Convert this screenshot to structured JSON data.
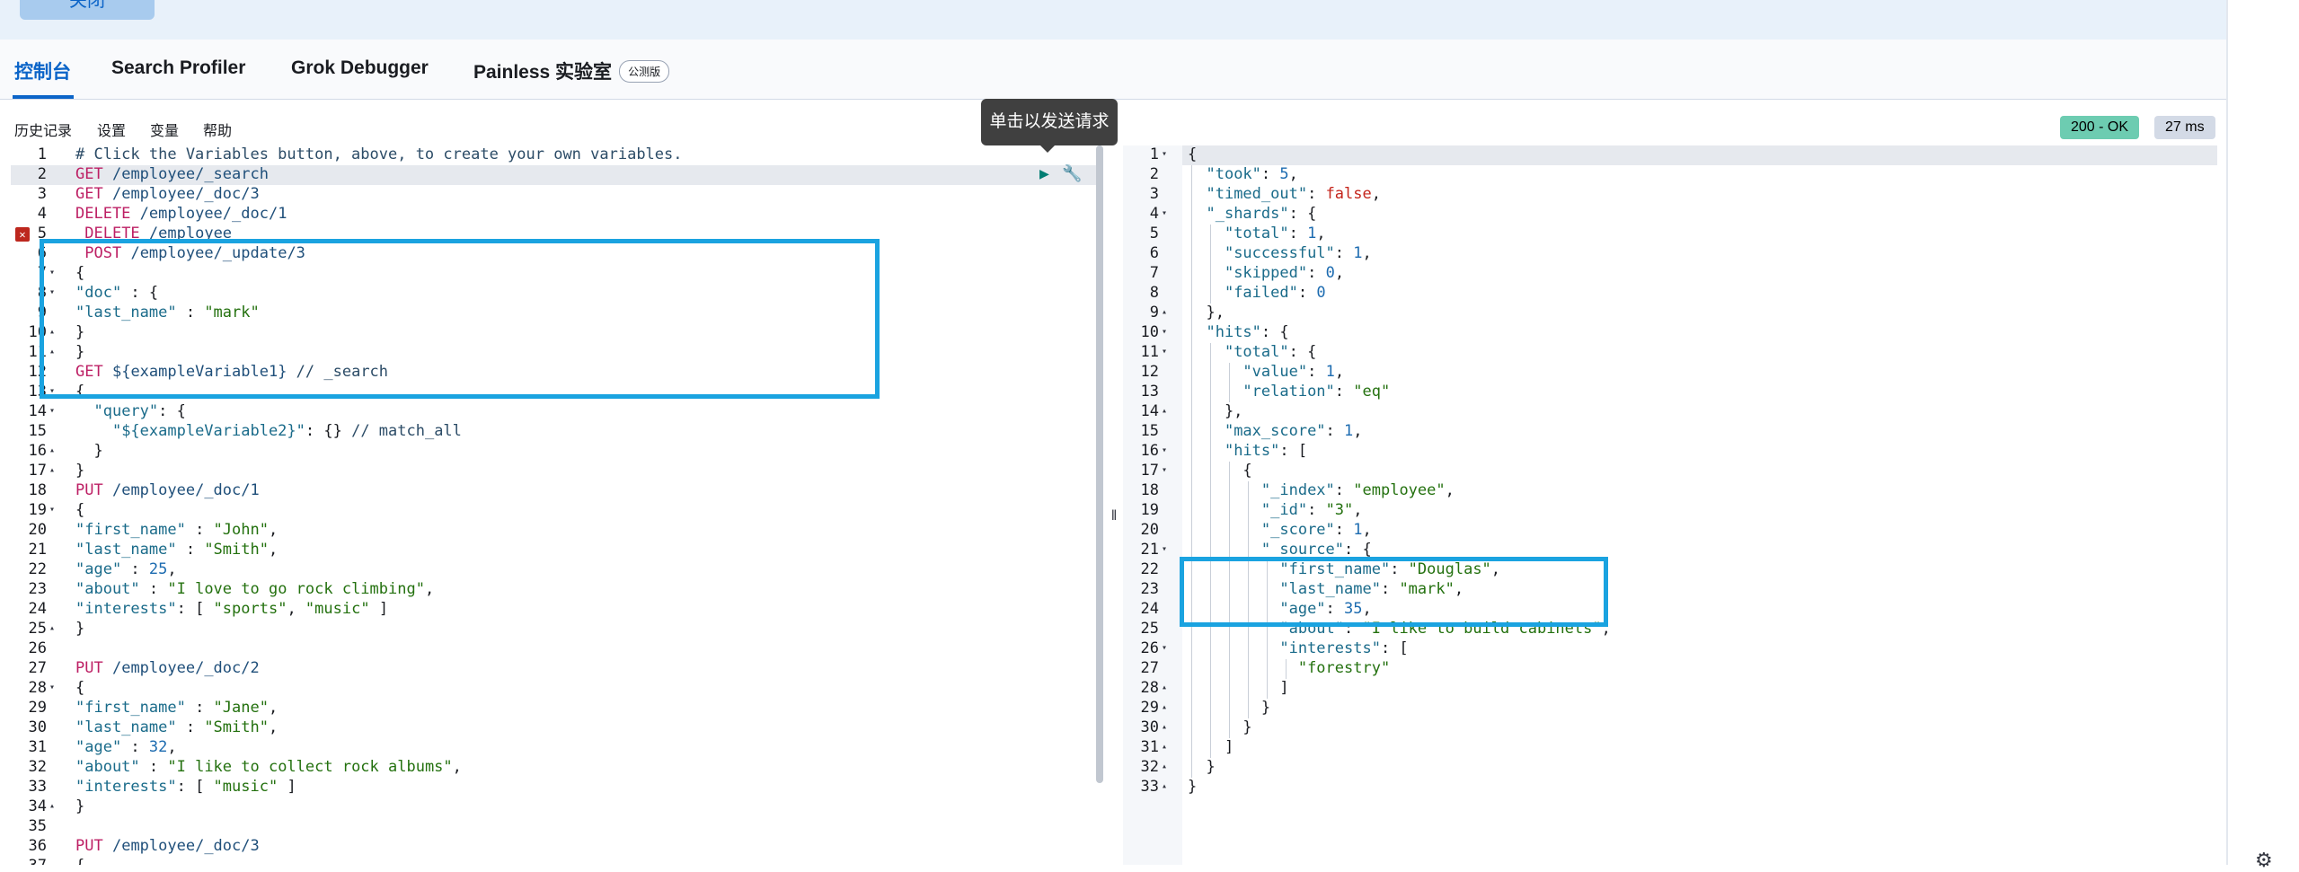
{
  "top": {
    "close_label": "关闭"
  },
  "tabs": [
    {
      "label": "控制台",
      "active": true
    },
    {
      "label": "Search Profiler"
    },
    {
      "label": "Grok Debugger"
    },
    {
      "label": "Painless 实验室",
      "badge": "公测版"
    }
  ],
  "toolbar": {
    "history": "历史记录",
    "settings": "设置",
    "variables": "变量",
    "help": "帮助"
  },
  "tooltip": "单击以发送请求",
  "status": {
    "code": "200 - OK",
    "time": "27 ms"
  },
  "request_lines": [
    "# Click the Variables button, above, to create your own variables.",
    "GET /employee/_search",
    "GET /employee/_doc/3",
    "DELETE /employee/_doc/1",
    " DELETE /employee",
    " POST /employee/_update/3",
    "{",
    "\"doc\" : {",
    "\"last_name\" : \"mark\"",
    "}",
    "}",
    "GET ${exampleVariable1} // _search",
    "{",
    "  \"query\": {",
    "    \"${exampleVariable2}\": {} // match_all",
    "  }",
    "}",
    "PUT /employee/_doc/1",
    "{",
    "\"first_name\" : \"John\",",
    "\"last_name\" : \"Smith\",",
    "\"age\" : 25,",
    "\"about\" : \"I love to go rock climbing\",",
    "\"interests\": [ \"sports\", \"music\" ]",
    "}",
    "",
    "PUT /employee/_doc/2",
    "{",
    "\"first_name\" : \"Jane\",",
    "\"last_name\" : \"Smith\",",
    "\"age\" : 32,",
    "\"about\" : \"I like to collect rock albums\",",
    "\"interests\": [ \"music\" ]",
    "}",
    "",
    "PUT /employee/_doc/3",
    "{"
  ],
  "response_lines": [
    "{",
    "  \"took\": 5,",
    "  \"timed_out\": false,",
    "  \"_shards\": {",
    "    \"total\": 1,",
    "    \"successful\": 1,",
    "    \"skipped\": 0,",
    "    \"failed\": 0",
    "  },",
    "  \"hits\": {",
    "    \"total\": {",
    "      \"value\": 1,",
    "      \"relation\": \"eq\"",
    "    },",
    "    \"max_score\": 1,",
    "    \"hits\": [",
    "      {",
    "        \"_index\": \"employee\",",
    "        \"_id\": \"3\",",
    "        \"_score\": 1,",
    "        \"_source\": {",
    "          \"first_name\": \"Douglas\",",
    "          \"last_name\": \"mark\",",
    "          \"age\": 35,",
    "          \"about\": \"I like to build cabinets\",",
    "          \"interests\": [",
    "            \"forestry\"",
    "          ]",
    "        }",
    "      }",
    "    ]",
    "  }",
    "}"
  ],
  "request_folds": {
    "7": "▾",
    "8": "▾",
    "10": "▴",
    "11": "▴",
    "13": "▾",
    "14": "▾",
    "16": "▴",
    "17": "▴",
    "19": "▾",
    "25": "▴",
    "28": "▾",
    "34": "▴"
  },
  "response_folds": {
    "1": "▾",
    "4": "▾",
    "9": "▴",
    "10": "▾",
    "11": "▾",
    "14": "▴",
    "16": "▾",
    "17": "▾",
    "21": "▾",
    "26": "▾",
    "28": "▴",
    "29": "▴",
    "30": "▴",
    "31": "▴",
    "32": "▴",
    "33": "▴"
  }
}
